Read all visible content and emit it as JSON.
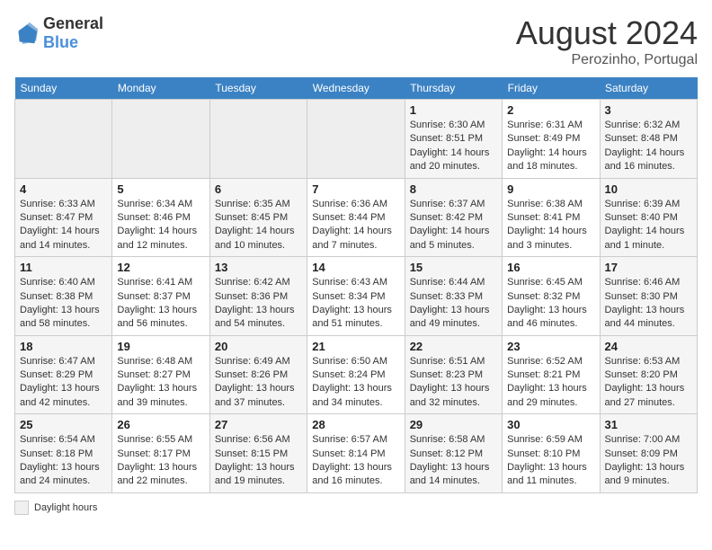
{
  "header": {
    "logo_general": "General",
    "logo_blue": "Blue",
    "month_year": "August 2024",
    "location": "Perozinho, Portugal"
  },
  "days_of_week": [
    "Sunday",
    "Monday",
    "Tuesday",
    "Wednesday",
    "Thursday",
    "Friday",
    "Saturday"
  ],
  "weeks": [
    [
      {
        "day": "",
        "empty": true
      },
      {
        "day": "",
        "empty": true
      },
      {
        "day": "",
        "empty": true
      },
      {
        "day": "",
        "empty": true
      },
      {
        "day": "1",
        "sunrise": "6:30 AM",
        "sunset": "8:51 PM",
        "daylight": "14 hours and 20 minutes."
      },
      {
        "day": "2",
        "sunrise": "6:31 AM",
        "sunset": "8:49 PM",
        "daylight": "14 hours and 18 minutes."
      },
      {
        "day": "3",
        "sunrise": "6:32 AM",
        "sunset": "8:48 PM",
        "daylight": "14 hours and 16 minutes."
      }
    ],
    [
      {
        "day": "4",
        "sunrise": "6:33 AM",
        "sunset": "8:47 PM",
        "daylight": "14 hours and 14 minutes."
      },
      {
        "day": "5",
        "sunrise": "6:34 AM",
        "sunset": "8:46 PM",
        "daylight": "14 hours and 12 minutes."
      },
      {
        "day": "6",
        "sunrise": "6:35 AM",
        "sunset": "8:45 PM",
        "daylight": "14 hours and 10 minutes."
      },
      {
        "day": "7",
        "sunrise": "6:36 AM",
        "sunset": "8:44 PM",
        "daylight": "14 hours and 7 minutes."
      },
      {
        "day": "8",
        "sunrise": "6:37 AM",
        "sunset": "8:42 PM",
        "daylight": "14 hours and 5 minutes."
      },
      {
        "day": "9",
        "sunrise": "6:38 AM",
        "sunset": "8:41 PM",
        "daylight": "14 hours and 3 minutes."
      },
      {
        "day": "10",
        "sunrise": "6:39 AM",
        "sunset": "8:40 PM",
        "daylight": "14 hours and 1 minute."
      }
    ],
    [
      {
        "day": "11",
        "sunrise": "6:40 AM",
        "sunset": "8:38 PM",
        "daylight": "13 hours and 58 minutes."
      },
      {
        "day": "12",
        "sunrise": "6:41 AM",
        "sunset": "8:37 PM",
        "daylight": "13 hours and 56 minutes."
      },
      {
        "day": "13",
        "sunrise": "6:42 AM",
        "sunset": "8:36 PM",
        "daylight": "13 hours and 54 minutes."
      },
      {
        "day": "14",
        "sunrise": "6:43 AM",
        "sunset": "8:34 PM",
        "daylight": "13 hours and 51 minutes."
      },
      {
        "day": "15",
        "sunrise": "6:44 AM",
        "sunset": "8:33 PM",
        "daylight": "13 hours and 49 minutes."
      },
      {
        "day": "16",
        "sunrise": "6:45 AM",
        "sunset": "8:32 PM",
        "daylight": "13 hours and 46 minutes."
      },
      {
        "day": "17",
        "sunrise": "6:46 AM",
        "sunset": "8:30 PM",
        "daylight": "13 hours and 44 minutes."
      }
    ],
    [
      {
        "day": "18",
        "sunrise": "6:47 AM",
        "sunset": "8:29 PM",
        "daylight": "13 hours and 42 minutes."
      },
      {
        "day": "19",
        "sunrise": "6:48 AM",
        "sunset": "8:27 PM",
        "daylight": "13 hours and 39 minutes."
      },
      {
        "day": "20",
        "sunrise": "6:49 AM",
        "sunset": "8:26 PM",
        "daylight": "13 hours and 37 minutes."
      },
      {
        "day": "21",
        "sunrise": "6:50 AM",
        "sunset": "8:24 PM",
        "daylight": "13 hours and 34 minutes."
      },
      {
        "day": "22",
        "sunrise": "6:51 AM",
        "sunset": "8:23 PM",
        "daylight": "13 hours and 32 minutes."
      },
      {
        "day": "23",
        "sunrise": "6:52 AM",
        "sunset": "8:21 PM",
        "daylight": "13 hours and 29 minutes."
      },
      {
        "day": "24",
        "sunrise": "6:53 AM",
        "sunset": "8:20 PM",
        "daylight": "13 hours and 27 minutes."
      }
    ],
    [
      {
        "day": "25",
        "sunrise": "6:54 AM",
        "sunset": "8:18 PM",
        "daylight": "13 hours and 24 minutes."
      },
      {
        "day": "26",
        "sunrise": "6:55 AM",
        "sunset": "8:17 PM",
        "daylight": "13 hours and 22 minutes."
      },
      {
        "day": "27",
        "sunrise": "6:56 AM",
        "sunset": "8:15 PM",
        "daylight": "13 hours and 19 minutes."
      },
      {
        "day": "28",
        "sunrise": "6:57 AM",
        "sunset": "8:14 PM",
        "daylight": "13 hours and 16 minutes."
      },
      {
        "day": "29",
        "sunrise": "6:58 AM",
        "sunset": "8:12 PM",
        "daylight": "13 hours and 14 minutes."
      },
      {
        "day": "30",
        "sunrise": "6:59 AM",
        "sunset": "8:10 PM",
        "daylight": "13 hours and 11 minutes."
      },
      {
        "day": "31",
        "sunrise": "7:00 AM",
        "sunset": "8:09 PM",
        "daylight": "13 hours and 9 minutes."
      }
    ]
  ],
  "legend": {
    "box_label": "Daylight hours"
  }
}
